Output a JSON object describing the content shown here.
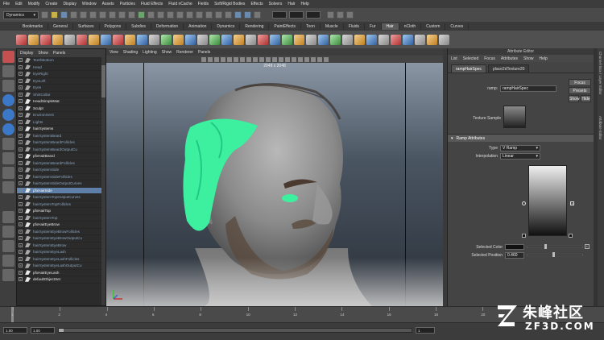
{
  "menubar": [
    "File",
    "Edit",
    "Modify",
    "Create",
    "Display",
    "Window",
    "Assets",
    "Particles",
    "Fluid Effects",
    "Fluid nCache",
    "Fields",
    "Soft/Rigid Bodies",
    "Effects",
    "Solvers",
    "Hair",
    "Help"
  ],
  "statusline": {
    "mode": "Dynamics"
  },
  "shelf_tabs": [
    "Bookmarks",
    "General",
    "Surfaces",
    "Polygons",
    "Subdivs",
    "Deformation",
    "Animation",
    "Dynamics",
    "Rendering",
    "PaintEffects",
    "Toon",
    "Muscle",
    "Fluids",
    "Fur",
    "Hair",
    "nCloth",
    "Custom",
    "Curves"
  ],
  "shelf_active_tab": "Hair",
  "outliner": {
    "menu": [
      "Display",
      "Show",
      "Panels"
    ],
    "rows": [
      {
        "label": "TeethBottom",
        "style": "blue"
      },
      {
        "label": "Head",
        "style": "blue"
      },
      {
        "label": "EyeRight",
        "style": "blue"
      },
      {
        "label": "EyeLeft",
        "style": "blue"
      },
      {
        "label": "Eyes",
        "style": "blue"
      },
      {
        "label": "ShirtCollar",
        "style": "blue"
      },
      {
        "label": "HeadSimpleMat",
        "style": "white"
      },
      {
        "label": "Sculpt",
        "style": "white"
      },
      {
        "label": "Environment",
        "style": "blue"
      },
      {
        "label": "Lights",
        "style": "blue"
      },
      {
        "label": "hairSystems",
        "style": "white"
      },
      {
        "label": "hairSystemBeard",
        "style": "blue"
      },
      {
        "label": "hairSystemBeardFollicles",
        "style": "blue"
      },
      {
        "label": "hairSystemBeardOutputCu",
        "style": "blue"
      },
      {
        "label": "pfxHairBeard",
        "style": "white"
      },
      {
        "label": "hairSystemBeardFollicles",
        "style": "blue"
      },
      {
        "label": "hairSystemSide",
        "style": "blue"
      },
      {
        "label": "hairSystemSideFollicles",
        "style": "blue"
      },
      {
        "label": "hairSystemSideOutputCurves",
        "style": "blue"
      },
      {
        "label": "pfxHairSide",
        "style": "selected"
      },
      {
        "label": "hairSystemTopOutputCurves",
        "style": "blue"
      },
      {
        "label": "hairSystemTopFollicles",
        "style": "blue"
      },
      {
        "label": "pfxHairTop",
        "style": "white"
      },
      {
        "label": "hairSystemTop",
        "style": "blue"
      },
      {
        "label": "pfxHairEyeBrow",
        "style": "white"
      },
      {
        "label": "hairSystemEyeBrowFollicles",
        "style": "blue"
      },
      {
        "label": "hairSystemEyeBrowOutputCu",
        "style": "blue"
      },
      {
        "label": "hairSystemEyeBrow",
        "style": "blue"
      },
      {
        "label": "hairSystemEyeLash",
        "style": "blue"
      },
      {
        "label": "hairSystemEyeLashFollicles",
        "style": "blue"
      },
      {
        "label": "hairSystemEyeLashOutputCu",
        "style": "blue"
      },
      {
        "label": "pfxHairEyeLash",
        "style": "white"
      },
      {
        "label": "defaultObjectSet",
        "style": "white"
      }
    ]
  },
  "viewport": {
    "menu": [
      "View",
      "Shading",
      "Lighting",
      "Show",
      "Renderer",
      "Panels"
    ],
    "resolution": "2048 x 2048"
  },
  "attribute_editor": {
    "title": "Attribute Editor",
    "menu": [
      "List",
      "Selected",
      "Focus",
      "Attributes",
      "Show",
      "Help"
    ],
    "tabs": [
      "rampHairSpec",
      "place2dTexture20"
    ],
    "active_tab": "rampHairSpec",
    "node_label": "ramp:",
    "node_value": "rampHairSpec",
    "buttons": [
      "Focus",
      "Presets",
      "Show",
      "Hide"
    ],
    "texture_sample_label": "Texture Sample",
    "section_title": "Ramp Attributes",
    "type_label": "Type",
    "type_value": "V Ramp",
    "interp_label": "Interpolation",
    "interp_value": "Linear",
    "selected_color_label": "Selected Color",
    "selected_position_label": "Selected Position",
    "selected_position_value": "0.460"
  },
  "channel_strip": [
    "Channel Box / Layer Editor",
    "Attribute Editor"
  ],
  "timeline": {
    "ticks": [
      "1",
      "2",
      "4",
      "6",
      "8",
      "10",
      "12",
      "14",
      "16",
      "18",
      "20",
      "22",
      "24"
    ]
  },
  "range": {
    "start": "1.00",
    "end": "1.00",
    "current": "1"
  },
  "watermark": {
    "title": "朱峰社区",
    "subtitle": "ZF3D.COM"
  },
  "colors": {
    "hair_green": "#3cf0a0",
    "selection": "#5d7fa8",
    "ui_bg": "#444444"
  }
}
